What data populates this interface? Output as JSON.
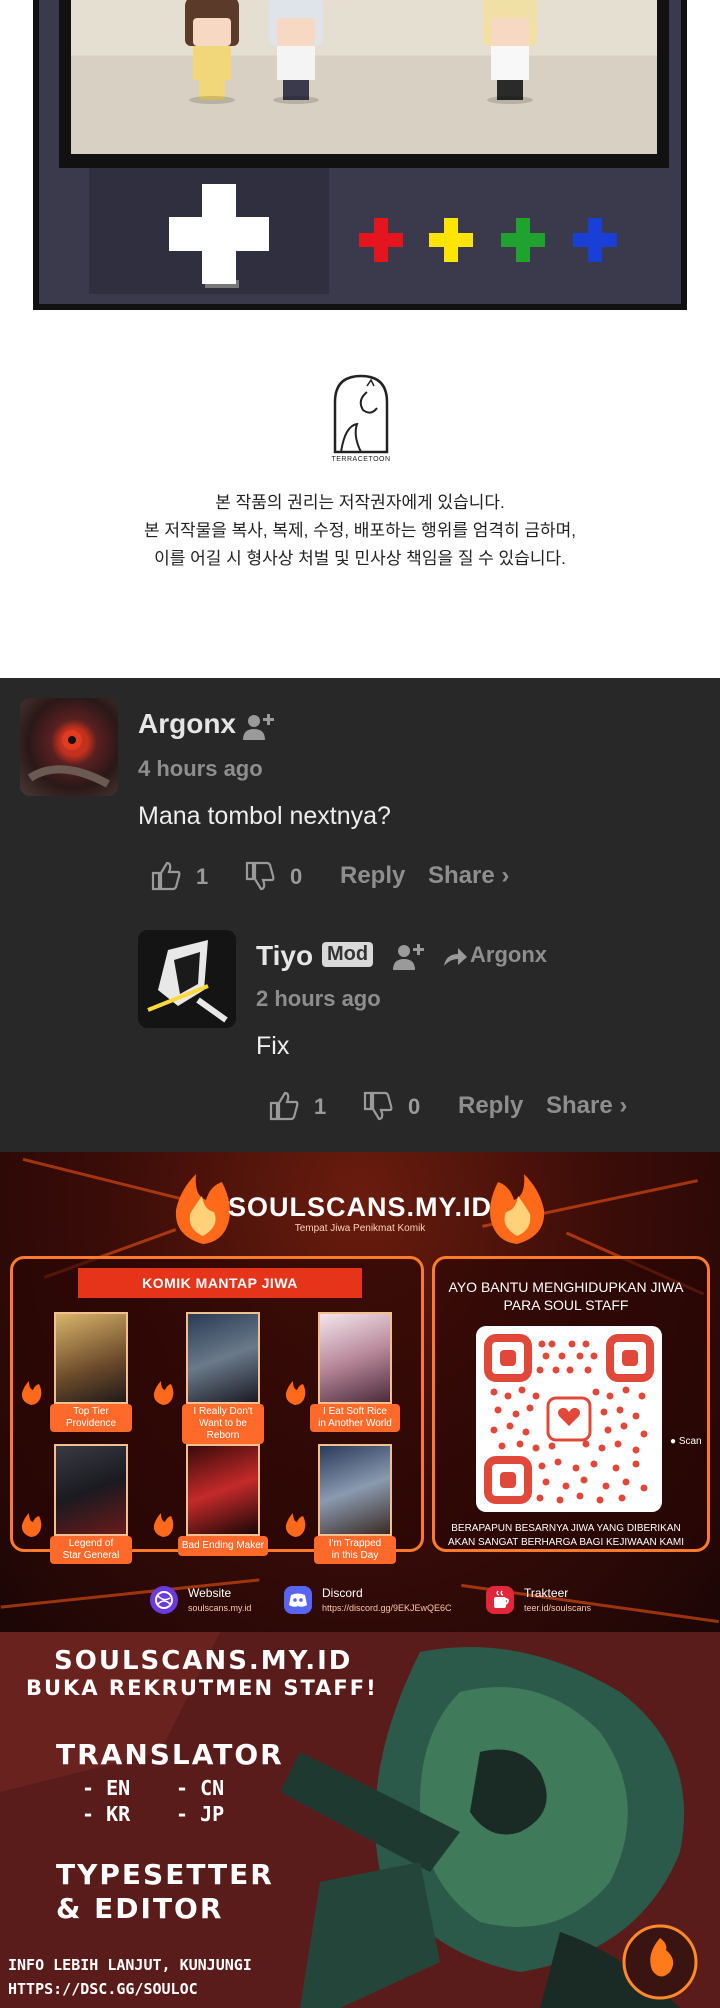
{
  "copyright": {
    "logo_text": "TERRACETOON",
    "line1": "본 작품의 권리는 저작권자에게 있습니다.",
    "line2": "본 저작물을 복사, 복제, 수정, 배포하는 행위를 엄격히 금하며,",
    "line3": "이를 어길 시 형사상 처벌 및 민사상 책임을 질 수 있습니다."
  },
  "comments": [
    {
      "user": "Argonx",
      "time": "4 hours ago",
      "text": "Mana tombol nextnya?",
      "likes": "1",
      "dislikes": "0",
      "reply_label": "Reply",
      "share_label": "Share ›"
    },
    {
      "user": "Tiyo",
      "badge": "Mod",
      "reply_to": "Argonx",
      "time": "2 hours ago",
      "text": "Fix",
      "likes": "1",
      "dislikes": "0",
      "reply_label": "Reply",
      "share_label": "Share ›"
    }
  ],
  "soulscans": {
    "site": "SOULSCANS.MY.ID",
    "tagline": "Tempat Jiwa Penikmat Komik",
    "komik_header": "KOMIK MANTAP JIWA",
    "comics": [
      {
        "title1": "Top Tier",
        "title2": "Providence"
      },
      {
        "title1": "I Really Don't",
        "title2": "Want to be Reborn"
      },
      {
        "title1": "I Eat Soft Rice",
        "title2": "in Another World"
      },
      {
        "title1": "Legend of",
        "title2": "Star General"
      },
      {
        "title1": "Bad Ending Maker",
        "title2": ""
      },
      {
        "title1": "I'm Trapped",
        "title2": "in this Day"
      }
    ],
    "support_title1": "AYO BANTU MENGHIDUPKAN JIWA",
    "support_title2": "PARA SOUL STAFF",
    "scan_label": "Scan",
    "support_foot1": "BERAPAPUN BESARNYA JIWA YANG DIBERIKAN",
    "support_foot2": "AKAN SANGAT BERHARGA BAGI KEJIWAAN KAMI",
    "links": [
      {
        "title": "Website",
        "sub": "soulscans.my.id"
      },
      {
        "title": "Discord",
        "sub": "https://discord.gg/9EKJEwQE6C"
      },
      {
        "title": "Trakteer",
        "sub": "teer.id/soulscans"
      }
    ]
  },
  "recruit": {
    "line1": "SOULSCANS.MY.ID",
    "line2": "BUKA REKRUTMEN STAFF!",
    "translator": "TRANSLATOR",
    "langs": [
      "- EN",
      "- CN",
      "- KR",
      "- JP"
    ],
    "typesetter": "TYPESETTER",
    "editor": "& EDITOR",
    "info1": "INFO LEBIH LANJUT, KUNJUNGI",
    "info2": "HTTPS://DSC.GG/SOULOC"
  },
  "colors": {
    "comment_bg": "#282828",
    "accent_orange": "#ff7a2a",
    "dpad_red": "#e4151c",
    "dpad_yellow": "#ffe500",
    "dpad_green": "#1fa22e",
    "dpad_blue": "#1a3fd6"
  }
}
